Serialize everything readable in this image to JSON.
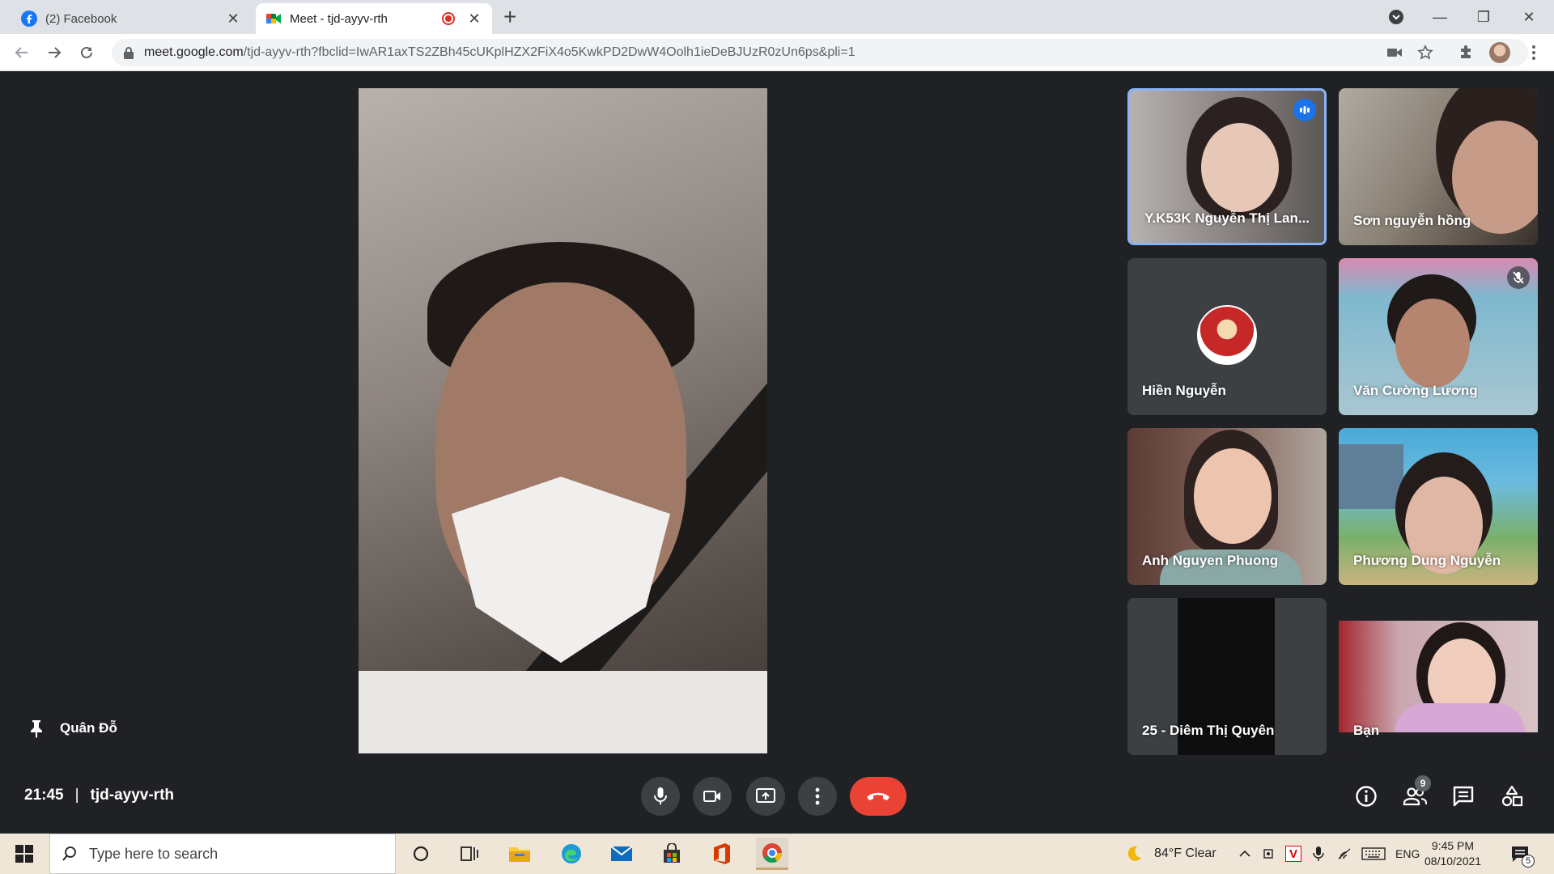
{
  "browser": {
    "tabs": [
      {
        "label": "(2) Facebook",
        "active": false
      },
      {
        "label": "Meet - tjd-ayyv-rth",
        "active": true
      }
    ],
    "url_host": "meet.google.com",
    "url_path": "/tjd-ayyv-rth?fbclid=IwAR1axTS2ZBh45cUKplHZX2FiX4o5KwkPD2DwW4Oolh1ieDeBJUzR0zUn6ps&pli=1"
  },
  "meet": {
    "pinned_name": "Quân Đỗ",
    "participants": [
      {
        "name": "Y.K53K Nguyễn Thị Lan...",
        "speaking": true
      },
      {
        "name": "Sơn nguyễn hồng"
      },
      {
        "name": "Hiền Nguyễn",
        "avatar": true
      },
      {
        "name": "Văn Cường Lương",
        "muted": true
      },
      {
        "name": "Anh Nguyen Phuong"
      },
      {
        "name": "Phương Dung Nguyễn"
      },
      {
        "name": "25 - Diêm Thị Quyên"
      },
      {
        "name": "Bạn"
      }
    ],
    "time": "21:45",
    "separator": "|",
    "meeting_code": "tjd-ayyv-rth",
    "people_count": "9"
  },
  "taskbar": {
    "search_placeholder": "Type here to search",
    "weather": "84°F  Clear",
    "language": "ENG",
    "time": "9:45 PM",
    "date": "08/10/2021",
    "notification_count": "5"
  },
  "colors": {
    "meet_bg": "#202124",
    "end_call": "#ea4335",
    "speaking_border": "#8ab4f8"
  }
}
